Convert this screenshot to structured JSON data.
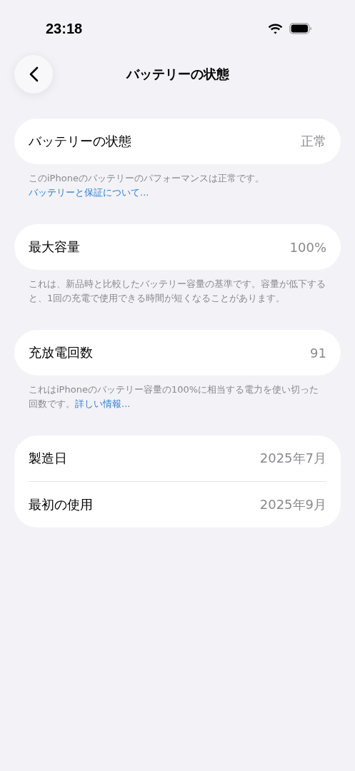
{
  "status_bar": {
    "time": "23:18"
  },
  "nav": {
    "title": "バッテリーの状態"
  },
  "sections": [
    {
      "rows": [
        {
          "label": "バッテリーの状態",
          "value": "正常"
        }
      ],
      "footer": {
        "text": "このiPhoneのバッテリーのパフォーマンスは正常です。",
        "link": "バッテリーと保証について..."
      }
    },
    {
      "rows": [
        {
          "label": "最大容量",
          "value": "100%"
        }
      ],
      "footer": {
        "text": "これは、新品時と比較したバッテリー容量の基準です。容量が低下すると、1回の充電で使用できる時間が短くなることがあります。"
      }
    },
    {
      "rows": [
        {
          "label": "充放電回数",
          "value": "91"
        }
      ],
      "footer": {
        "text": "これはiPhoneのバッテリー容量の100%に相当する電力を使い切った回数です。",
        "link": "詳しい情報..."
      }
    },
    {
      "rows": [
        {
          "label": "製造日",
          "value": "2025年7月"
        },
        {
          "label": "最初の使用",
          "value": "2025年9月"
        }
      ]
    }
  ]
}
